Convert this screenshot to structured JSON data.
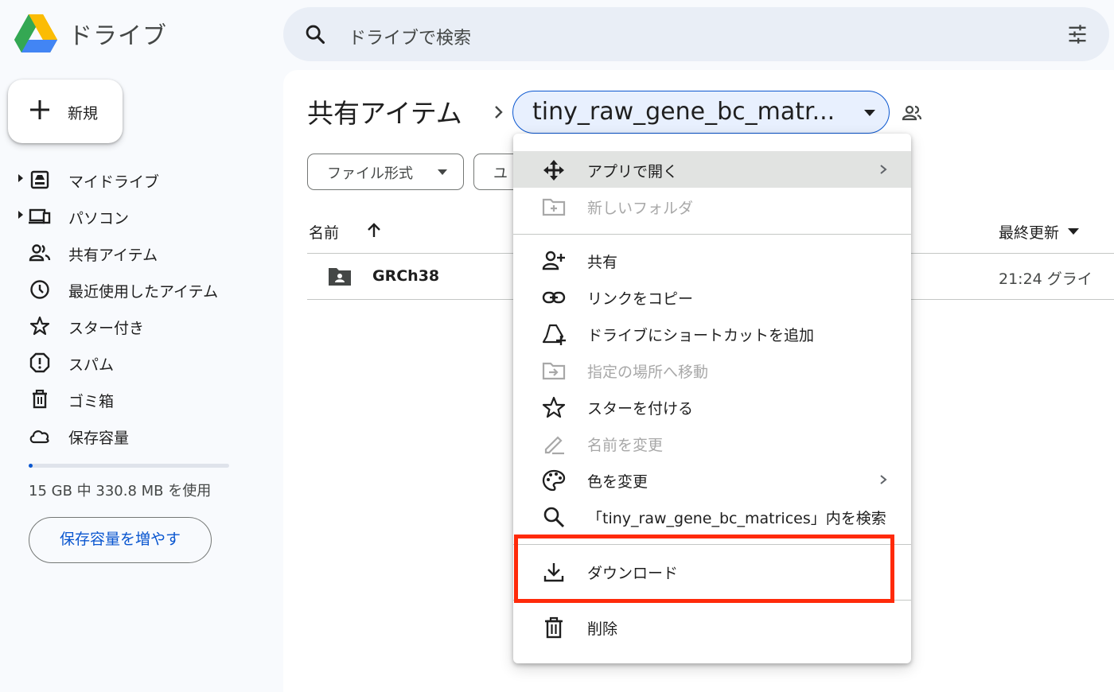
{
  "header": {
    "brand": "ドライブ",
    "search_placeholder": "ドライブで検索"
  },
  "sidebar": {
    "new_label": "新規",
    "items": [
      {
        "label": "マイドライブ",
        "icon": "my-drive-icon"
      },
      {
        "label": "パソコン",
        "icon": "computers-icon"
      },
      {
        "label": "共有アイテム",
        "icon": "shared-icon"
      },
      {
        "label": "最近使用したアイテム",
        "icon": "clock-icon"
      },
      {
        "label": "スター付き",
        "icon": "star-icon"
      },
      {
        "label": "スパム",
        "icon": "spam-icon"
      },
      {
        "label": "ゴミ箱",
        "icon": "trash-icon"
      },
      {
        "label": "保存容量",
        "icon": "cloud-icon"
      }
    ],
    "storage_used_fraction": 0.02,
    "storage_text": "15 GB 中 330.8 MB を使用",
    "storage_button": "保存容量を増やす"
  },
  "breadcrumb": {
    "root": "共有アイテム",
    "current": "tiny_raw_gene_bc_matr..."
  },
  "filters": {
    "file_type": "ファイル形式",
    "people_partial": "ユ"
  },
  "list": {
    "col_name": "名前",
    "col_modified": "最終更新",
    "rows": [
      {
        "name": "GRCh38",
        "modified": "21:24 グライ"
      }
    ]
  },
  "menu": {
    "items": [
      {
        "label": "アプリで開く",
        "icon": "open-with-icon",
        "disabled": false,
        "submenu": true
      },
      {
        "label": "新しいフォルダ",
        "icon": "new-folder-icon",
        "disabled": true
      },
      {
        "label": "共有",
        "icon": "person-add-icon",
        "disabled": false
      },
      {
        "label": "リンクをコピー",
        "icon": "link-icon",
        "disabled": false
      },
      {
        "label": "ドライブにショートカットを追加",
        "icon": "add-shortcut-icon",
        "disabled": false
      },
      {
        "label": "指定の場所へ移動",
        "icon": "move-to-icon",
        "disabled": true
      },
      {
        "label": "スターを付ける",
        "icon": "star-icon",
        "disabled": false
      },
      {
        "label": "名前を変更",
        "icon": "rename-icon",
        "disabled": true
      },
      {
        "label": "色を変更",
        "icon": "palette-icon",
        "disabled": false,
        "submenu": true
      },
      {
        "label": "「tiny_raw_gene_bc_matrices」内を検索",
        "icon": "search-icon",
        "disabled": false
      },
      {
        "label": "ダウンロード",
        "icon": "download-icon",
        "disabled": false
      },
      {
        "label": "削除",
        "icon": "trash-icon",
        "disabled": false
      }
    ]
  },
  "colors": {
    "accent": "#0b57d0",
    "highlight": "#ff2a0a"
  }
}
